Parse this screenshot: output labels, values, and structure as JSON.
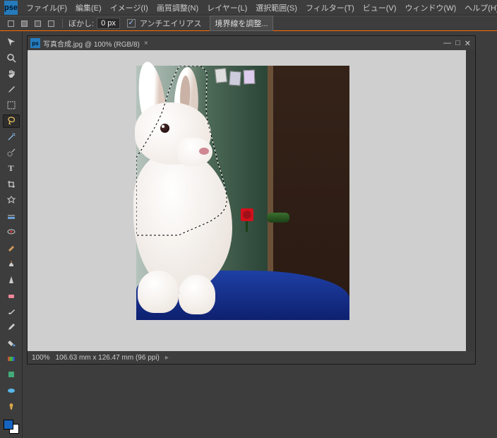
{
  "logo": "pse",
  "menu": {
    "file": "ファイル(F)",
    "edit": "編集(E)",
    "image": "イメージ(I)",
    "adjust": "画質調整(N)",
    "layer": "レイヤー(L)",
    "select": "選択範囲(S)",
    "filter": "フィルター(T)",
    "view": "ビュー(V)",
    "window": "ウィンドウ(W)",
    "help": "ヘルプ(H)"
  },
  "options": {
    "feather_label": "ぼかし:",
    "feather_value": "0 px",
    "antialias_label": "アンチエイリアス",
    "refine_edge": "境界線を調整..."
  },
  "doc": {
    "title": "写真合成.jpg @ 100% (RGB/8)",
    "zoom": "100%",
    "dims": "106.63 mm x 126.47 mm (96 ppi)"
  },
  "tools": {
    "move": "move",
    "zoom": "zoom",
    "hand": "hand",
    "eyedrop": "eyedrop",
    "marquee": "marquee",
    "lasso": "lasso",
    "wand": "wand",
    "qselect": "qselect",
    "type": "type",
    "crop": "crop",
    "cookie": "cookie",
    "straighten": "straighten",
    "redeye": "redeye",
    "heal": "heal",
    "clone": "clone",
    "sharpen": "sharpen",
    "eraser": "eraser",
    "brush": "brush",
    "pencil": "pencil",
    "bucket": "bucket",
    "gradient": "gradient",
    "shape": "shape",
    "sponge": "sponge",
    "smudge": "smudge"
  },
  "swatch": {
    "fg": "#1665c1",
    "bg": "#ffffff"
  }
}
